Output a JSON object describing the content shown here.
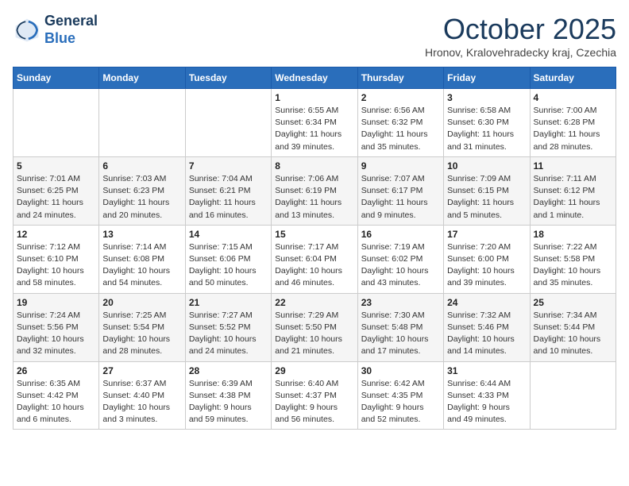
{
  "header": {
    "logo_line1": "General",
    "logo_line2": "Blue",
    "month_title": "October 2025",
    "location": "Hronov, Kralovehradecky kraj, Czechia"
  },
  "weekdays": [
    "Sunday",
    "Monday",
    "Tuesday",
    "Wednesday",
    "Thursday",
    "Friday",
    "Saturday"
  ],
  "weeks": [
    [
      {
        "day": "",
        "info": ""
      },
      {
        "day": "",
        "info": ""
      },
      {
        "day": "",
        "info": ""
      },
      {
        "day": "1",
        "info": "Sunrise: 6:55 AM\nSunset: 6:34 PM\nDaylight: 11 hours\nand 39 minutes."
      },
      {
        "day": "2",
        "info": "Sunrise: 6:56 AM\nSunset: 6:32 PM\nDaylight: 11 hours\nand 35 minutes."
      },
      {
        "day": "3",
        "info": "Sunrise: 6:58 AM\nSunset: 6:30 PM\nDaylight: 11 hours\nand 31 minutes."
      },
      {
        "day": "4",
        "info": "Sunrise: 7:00 AM\nSunset: 6:28 PM\nDaylight: 11 hours\nand 28 minutes."
      }
    ],
    [
      {
        "day": "5",
        "info": "Sunrise: 7:01 AM\nSunset: 6:25 PM\nDaylight: 11 hours\nand 24 minutes."
      },
      {
        "day": "6",
        "info": "Sunrise: 7:03 AM\nSunset: 6:23 PM\nDaylight: 11 hours\nand 20 minutes."
      },
      {
        "day": "7",
        "info": "Sunrise: 7:04 AM\nSunset: 6:21 PM\nDaylight: 11 hours\nand 16 minutes."
      },
      {
        "day": "8",
        "info": "Sunrise: 7:06 AM\nSunset: 6:19 PM\nDaylight: 11 hours\nand 13 minutes."
      },
      {
        "day": "9",
        "info": "Sunrise: 7:07 AM\nSunset: 6:17 PM\nDaylight: 11 hours\nand 9 minutes."
      },
      {
        "day": "10",
        "info": "Sunrise: 7:09 AM\nSunset: 6:15 PM\nDaylight: 11 hours\nand 5 minutes."
      },
      {
        "day": "11",
        "info": "Sunrise: 7:11 AM\nSunset: 6:12 PM\nDaylight: 11 hours\nand 1 minute."
      }
    ],
    [
      {
        "day": "12",
        "info": "Sunrise: 7:12 AM\nSunset: 6:10 PM\nDaylight: 10 hours\nand 58 minutes."
      },
      {
        "day": "13",
        "info": "Sunrise: 7:14 AM\nSunset: 6:08 PM\nDaylight: 10 hours\nand 54 minutes."
      },
      {
        "day": "14",
        "info": "Sunrise: 7:15 AM\nSunset: 6:06 PM\nDaylight: 10 hours\nand 50 minutes."
      },
      {
        "day": "15",
        "info": "Sunrise: 7:17 AM\nSunset: 6:04 PM\nDaylight: 10 hours\nand 46 minutes."
      },
      {
        "day": "16",
        "info": "Sunrise: 7:19 AM\nSunset: 6:02 PM\nDaylight: 10 hours\nand 43 minutes."
      },
      {
        "day": "17",
        "info": "Sunrise: 7:20 AM\nSunset: 6:00 PM\nDaylight: 10 hours\nand 39 minutes."
      },
      {
        "day": "18",
        "info": "Sunrise: 7:22 AM\nSunset: 5:58 PM\nDaylight: 10 hours\nand 35 minutes."
      }
    ],
    [
      {
        "day": "19",
        "info": "Sunrise: 7:24 AM\nSunset: 5:56 PM\nDaylight: 10 hours\nand 32 minutes."
      },
      {
        "day": "20",
        "info": "Sunrise: 7:25 AM\nSunset: 5:54 PM\nDaylight: 10 hours\nand 28 minutes."
      },
      {
        "day": "21",
        "info": "Sunrise: 7:27 AM\nSunset: 5:52 PM\nDaylight: 10 hours\nand 24 minutes."
      },
      {
        "day": "22",
        "info": "Sunrise: 7:29 AM\nSunset: 5:50 PM\nDaylight: 10 hours\nand 21 minutes."
      },
      {
        "day": "23",
        "info": "Sunrise: 7:30 AM\nSunset: 5:48 PM\nDaylight: 10 hours\nand 17 minutes."
      },
      {
        "day": "24",
        "info": "Sunrise: 7:32 AM\nSunset: 5:46 PM\nDaylight: 10 hours\nand 14 minutes."
      },
      {
        "day": "25",
        "info": "Sunrise: 7:34 AM\nSunset: 5:44 PM\nDaylight: 10 hours\nand 10 minutes."
      }
    ],
    [
      {
        "day": "26",
        "info": "Sunrise: 6:35 AM\nSunset: 4:42 PM\nDaylight: 10 hours\nand 6 minutes."
      },
      {
        "day": "27",
        "info": "Sunrise: 6:37 AM\nSunset: 4:40 PM\nDaylight: 10 hours\nand 3 minutes."
      },
      {
        "day": "28",
        "info": "Sunrise: 6:39 AM\nSunset: 4:38 PM\nDaylight: 9 hours\nand 59 minutes."
      },
      {
        "day": "29",
        "info": "Sunrise: 6:40 AM\nSunset: 4:37 PM\nDaylight: 9 hours\nand 56 minutes."
      },
      {
        "day": "30",
        "info": "Sunrise: 6:42 AM\nSunset: 4:35 PM\nDaylight: 9 hours\nand 52 minutes."
      },
      {
        "day": "31",
        "info": "Sunrise: 6:44 AM\nSunset: 4:33 PM\nDaylight: 9 hours\nand 49 minutes."
      },
      {
        "day": "",
        "info": ""
      }
    ]
  ]
}
